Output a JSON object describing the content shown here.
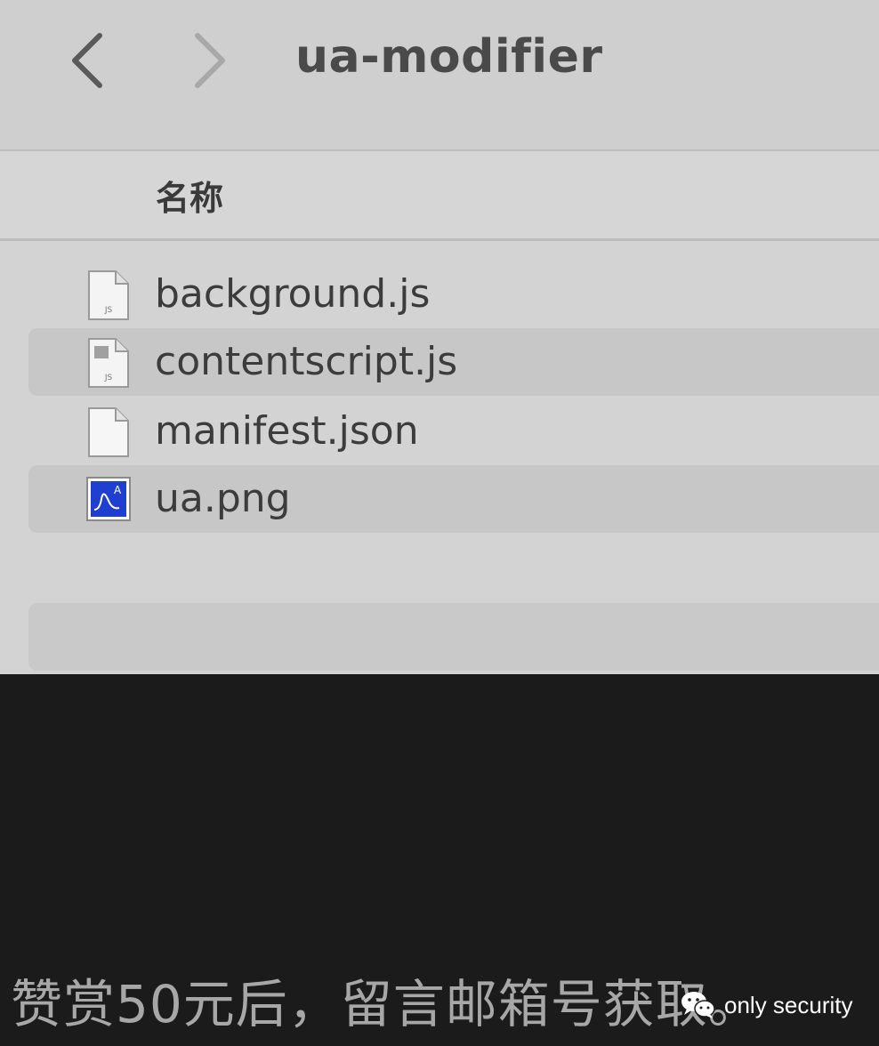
{
  "window": {
    "title": "ua-modifier"
  },
  "column_header": {
    "name_label": "名称"
  },
  "files": [
    {
      "name": "background.js",
      "icon": "js-file-icon"
    },
    {
      "name": "contentscript.js",
      "icon": "js-file-icon"
    },
    {
      "name": "manifest.json",
      "icon": "document-icon"
    },
    {
      "name": "ua.png",
      "icon": "image-file-icon"
    }
  ],
  "caption": {
    "text": "赞赏50元后，留言邮箱号获取。"
  },
  "watermark": {
    "text": "only security",
    "icon": "wechat-icon"
  },
  "colors": {
    "finder_bg": "#d3d3d3",
    "row_stripe": "#c7c7c7",
    "bottom_bg": "#1b1b1b",
    "caption_text": "#a7a7a7",
    "image_icon_blue": "#1f3fd0"
  }
}
